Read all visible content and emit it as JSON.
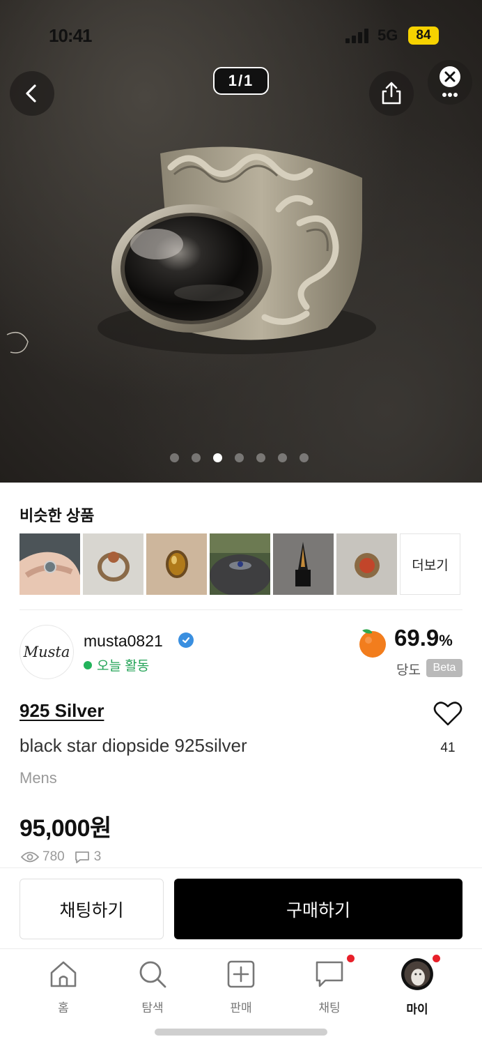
{
  "status_bar": {
    "time": "10:41",
    "network": "5G",
    "battery": "84"
  },
  "gallery": {
    "counter": "1/1",
    "dot_count": 7,
    "active_index": 2
  },
  "similar": {
    "title": "비슷한 상품",
    "more_label": "더보기",
    "thumbnails": [
      "ring-on-hand",
      "gold-ring",
      "amber-stone-ring",
      "rings-on-stump",
      "black-stone-ring",
      "red-stone-ring"
    ]
  },
  "seller": {
    "avatar_text": "Musta",
    "name": "musta0821",
    "activity": "오늘 활동",
    "sweetness_value": "69.9",
    "sweetness_unit": "%",
    "sweetness_label": "당도",
    "beta_label": "Beta"
  },
  "product": {
    "brand": "925 Silver",
    "title": "black star diopside 925silver",
    "category": "Mens",
    "price": "95,000원",
    "likes": "41",
    "views": "780",
    "comments": "3"
  },
  "actions": {
    "chat": "채팅하기",
    "buy": "구매하기"
  },
  "tabs": [
    {
      "label": "홈",
      "icon": "home-icon"
    },
    {
      "label": "탐색",
      "icon": "search-icon"
    },
    {
      "label": "판매",
      "icon": "plus-square-icon"
    },
    {
      "label": "채팅",
      "icon": "chat-bubble-icon"
    },
    {
      "label": "마이",
      "icon": "profile-avatar"
    }
  ],
  "colors": {
    "accent_green": "#22a356",
    "verified_blue": "#3a8fe0",
    "notification_red": "#e8202a",
    "battery_yellow": "#f6d200"
  }
}
